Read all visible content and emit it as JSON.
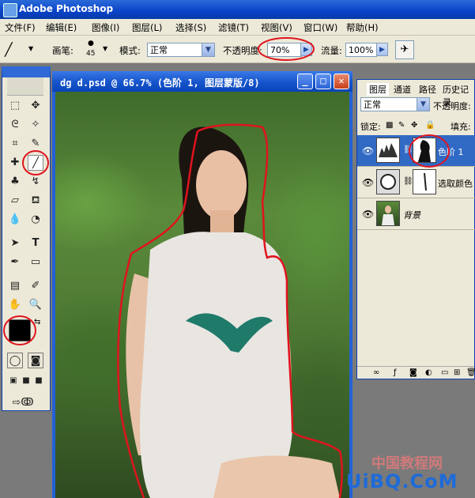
{
  "app": {
    "title": "Adobe Photoshop"
  },
  "menu": [
    "文件(F)",
    "编辑(E)",
    "图像(I)",
    "图层(L)",
    "选择(S)",
    "滤镜(T)",
    "视图(V)",
    "窗口(W)",
    "帮助(H)"
  ],
  "options": {
    "brush_label": "画笔:",
    "brush_size": "45",
    "mode_label": "模式:",
    "mode_value": "正常",
    "opacity_label": "不透明度:",
    "opacity_value": "70%",
    "flow_label": "流量:",
    "flow_value": "100%"
  },
  "document": {
    "title": "dg d.psd @ 66.7% (色阶 1, 图层蒙版/8)"
  },
  "layers_panel": {
    "tabs": [
      "图层",
      "通道",
      "路径",
      "历史记录"
    ],
    "blend_mode": "正常",
    "opacity_label": "不透明度:",
    "lock_label": "锁定:",
    "fill_label": "填充:",
    "layers": [
      {
        "name": "色阶 1",
        "active": true
      },
      {
        "name": "选取颜色",
        "active": false
      },
      {
        "name": "背景",
        "active": false
      }
    ]
  },
  "watermark": {
    "cn": "中国教程网",
    "en": "UiBQ.CoM"
  },
  "colors": {
    "title_blue": "#0a43c8",
    "annotation_red": "#e0141e",
    "selection_blue": "#316ac5"
  },
  "icons": [
    "brush-icon",
    "marquee-icon",
    "move-icon",
    "lasso-icon",
    "magic-wand-icon",
    "crop-icon",
    "eyedropper-icon",
    "healing-icon",
    "clone-icon",
    "eraser-icon",
    "bucket-icon",
    "blur-icon",
    "dodge-icon",
    "path-select-icon",
    "type-icon",
    "pen-icon",
    "shape-icon",
    "notes-icon",
    "hand-icon",
    "zoom-icon",
    "eye-icon",
    "link-icon",
    "mask-icon"
  ]
}
